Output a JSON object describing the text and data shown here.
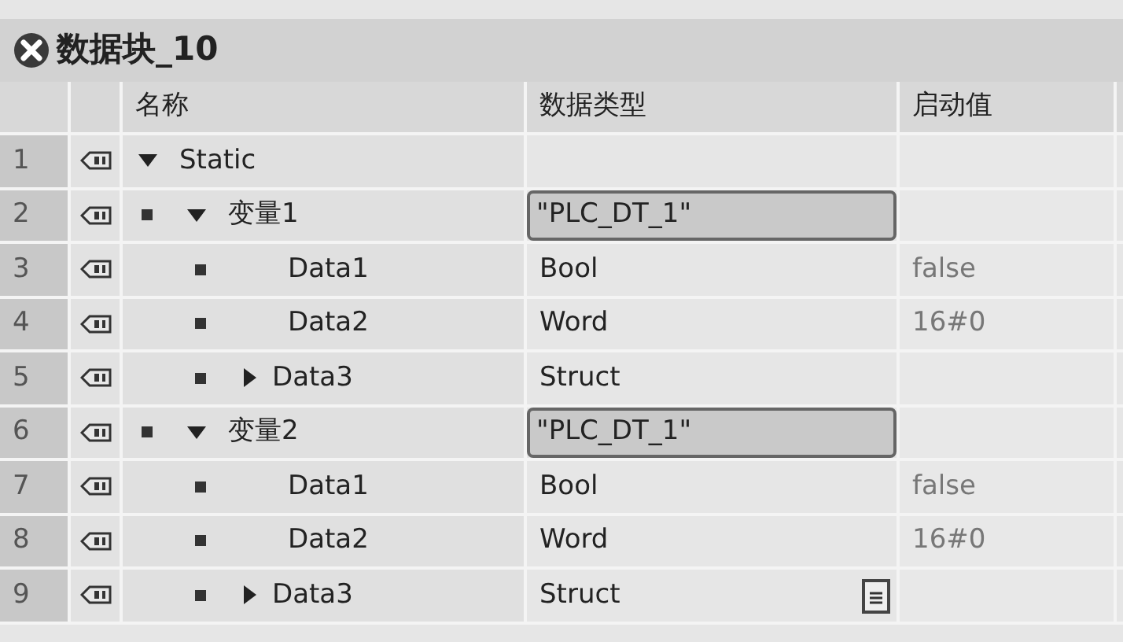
{
  "block": {
    "title": "数据块_10"
  },
  "columns": [
    "名称",
    "数据类型",
    "启动值"
  ],
  "rows": [
    {
      "number": "1",
      "name": "Static",
      "expanded": true,
      "children": [
        {
          "number": "2",
          "name": "变量1",
          "type": "\"PLC_DT_1\"",
          "expanded": true,
          "highlighted": true,
          "children": [
            {
              "number": "3",
              "name": "Data1",
              "type": "Bool",
              "start": "false"
            },
            {
              "number": "4",
              "name": "Data2",
              "type": "Word",
              "start": "16#0"
            },
            {
              "number": "5",
              "name": "Data3",
              "type": "Struct",
              "expanded": false
            }
          ]
        },
        {
          "number": "6",
          "name": "变量2",
          "type": "\"PLC_DT_1\"",
          "expanded": true,
          "highlighted": true,
          "children": [
            {
              "number": "7",
              "name": "Data1",
              "type": "Bool",
              "start": "false"
            },
            {
              "number": "8",
              "name": "Data2",
              "type": "Word",
              "start": "16#0"
            },
            {
              "number": "9",
              "name": "Data3",
              "type": "Struct",
              "expanded": false,
              "list_button": true
            }
          ]
        }
      ]
    }
  ]
}
